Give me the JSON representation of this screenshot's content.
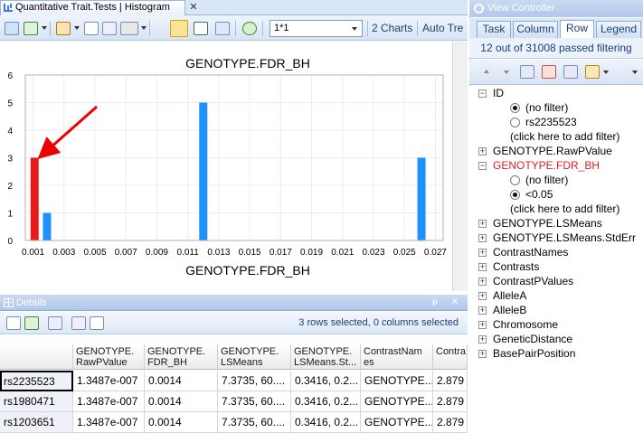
{
  "histogram_window": {
    "tab_title": "Quantitative Trait.Tests | Histogram",
    "zoom_value": "1*1",
    "charts_label": "2 Charts",
    "auto_label": "Auto Tre"
  },
  "chart_data": {
    "type": "bar",
    "title": "GENOTYPE.FDR_BH",
    "xlabel": "GENOTYPE.FDR_BH",
    "ylabel": "",
    "xlim": [
      0.0005,
      0.0275
    ],
    "ylim": [
      0,
      6
    ],
    "x_ticks": [
      "0.001",
      "0.003",
      "0.005",
      "0.007",
      "0.009",
      "0.011",
      "0.013",
      "0.015",
      "0.017",
      "0.019",
      "0.021",
      "0.023",
      "0.025",
      "0.027"
    ],
    "y_ticks": [
      "0",
      "1",
      "2",
      "3",
      "4",
      "5",
      "6"
    ],
    "bars": [
      {
        "x": 0.0011,
        "value": 3,
        "color": "#e41a1c"
      },
      {
        "x": 0.0019,
        "value": 1,
        "color": "#1e90ff"
      },
      {
        "x": 0.012,
        "value": 5,
        "color": "#1e90ff"
      },
      {
        "x": 0.0261,
        "value": 3,
        "color": "#1e90ff"
      }
    ]
  },
  "details": {
    "title": "Details",
    "status": "3 rows selected, 0 columns selected",
    "columns": [
      "",
      "GENOTYPE.\nRawPValue",
      "GENOTYPE.\nFDR_BH",
      "GENOTYPE.\nLSMeans",
      "GENOTYPE.\nLSMeans.St...",
      "ContrastNam\nes",
      "Contra"
    ],
    "rows": [
      [
        "rs2235523",
        "1.3487e-007",
        "0.0014",
        "7.3735, 60....",
        "0.3416, 0.2...",
        "GENOTYPE....",
        "2.879"
      ],
      [
        "rs1980471",
        "1.3487e-007",
        "0.0014",
        "7.3735, 60....",
        "0.3416, 0.2...",
        "GENOTYPE....",
        "2.879"
      ],
      [
        "rs1203651",
        "1.3487e-007",
        "0.0014",
        "7.3735, 60....",
        "0.3416, 0.2...",
        "GENOTYPE....",
        "2.879"
      ]
    ]
  },
  "view_controller": {
    "title": "View Controller",
    "tabs": [
      "Task",
      "Column",
      "Row",
      "Legend"
    ],
    "active_tab": "Row",
    "filter_status": "12 out of 31008 passed filtering",
    "tree": {
      "id_label": "ID",
      "id_no_filter": "(no filter)",
      "id_value": "rs2235523",
      "add_filter": "(click here to add filter)",
      "rawp_label": "GENOTYPE.RawPValue",
      "fdr_label": "GENOTYPE.FDR_BH",
      "fdr_no_filter": "(no filter)",
      "fdr_value": "<0.05",
      "fdr_add_filter": "(click here to add filter)",
      "others": [
        "GENOTYPE.LSMeans",
        "GENOTYPE.LSMeans.StdErr",
        "ContrastNames",
        "Contrasts",
        "ContrastPValues",
        "AlleleA",
        "AlleleB",
        "Chromosome",
        "GeneticDistance",
        "BasePairPosition"
      ]
    }
  }
}
